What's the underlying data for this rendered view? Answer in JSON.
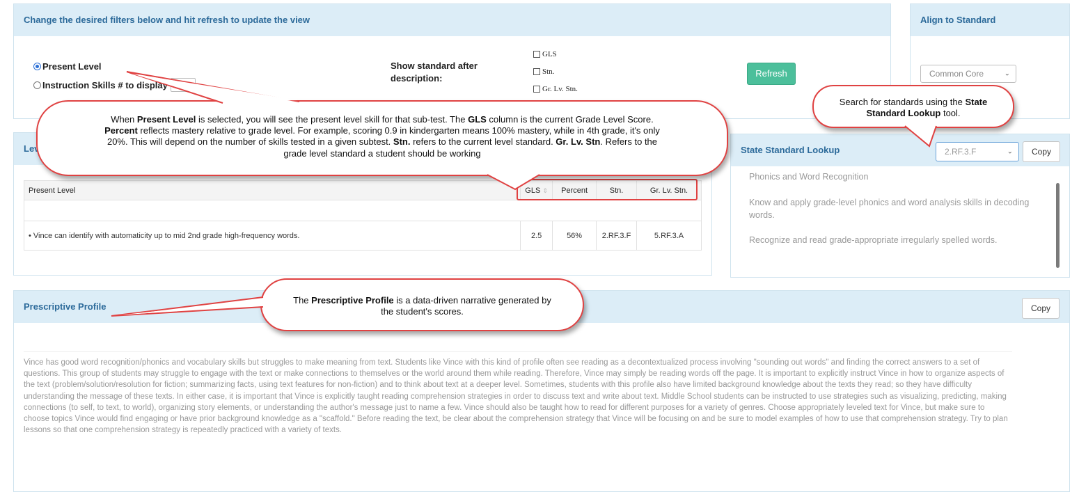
{
  "filters": {
    "header": "Change the desired filters below and hit refresh to update the view",
    "radio_present": "Present Level",
    "radio_instruction": "Instruction Skills # to display",
    "show_standard_label": "Show standard after description:",
    "checkboxes": [
      "GLS",
      "Stn.",
      "Gr. Lv. Stn."
    ],
    "refresh_label": "Refresh"
  },
  "align": {
    "header": "Align to Standard",
    "select_value": "Common Core"
  },
  "present": {
    "header": "Lev",
    "columns": [
      "Present Level",
      "GLS",
      "Percent",
      "Stn.",
      "Gr. Lv. Stn."
    ],
    "rows": [
      {
        "text": "• Vince can identify with automaticity up to mid 2nd grade high-frequency words.",
        "gls": "2.5",
        "percent": "56%",
        "stn": "2.RF.3.F",
        "gr_lv_stn": "5.RF.3.A"
      }
    ]
  },
  "lookup": {
    "header": "State Standard Lookup",
    "select_value": "2.RF.3.F",
    "copy_label": "Copy",
    "items": [
      "Phonics and Word Recognition",
      "Know and apply grade-level phonics and word analysis skills in decoding words.",
      "Recognize and read grade-appropriate irregularly spelled words."
    ]
  },
  "profile": {
    "header": "Prescriptive Profile",
    "copy_label": "Copy",
    "text": "Vince has good word recognition/phonics and vocabulary skills but struggles to make meaning from text. Students like Vince with this kind of profile often see reading as a decontextualized process involving \"sounding out words\" and finding the correct answers to a set of questions. This group of students may struggle to engage with the text or make connections to themselves or the world around them while reading. Therefore, Vince  may simply be reading words off the page. It is important to explicitly instruct Vince in how to organize aspects of the text (problem/solution/resolution for fiction; summarizing facts, using text features for non-fiction) and to think about text at a deeper level. Sometimes, students with this profile also have limited background knowledge about the texts they read; so they have difficulty understanding the message of these texts. In either case, it is important that Vince is explicitly taught reading comprehension strategies in order to discuss text and write about text. Middle School students can be instructed to use strategies such as visualizing, predicting, making connections (to self, to text, to world), organizing story elements, or understanding the author's message just to name a few. Vince should also be taught how to read for different purposes for a variety of genres. Choose appropriately leveled text for Vince, but make sure to choose topics Vince would find engaging or have prior background knowledge as a \"scaffold.\" Before reading the text, be clear about the comprehension strategy that Vince will be focusing on and be sure to model examples of how to use that comprehension strategy. Try to plan lessons so that one comprehension strategy is repeatedly practiced with a variety of texts."
  },
  "callouts": {
    "present_level": {
      "t1": "When ",
      "b1": "Present Level",
      "t2": " is selected, you will see the present level skill for that sub-test. The ",
      "b2": "GLS",
      "t3": " column is the current Grade Level Score. ",
      "b3": "Percent",
      "t4": " reflects mastery relative to grade level. For example, scoring 0.9 in kindergarten means 100% mastery, while in 4th grade, it's only 20%. This will depend on the number of skills tested in a given subtest. ",
      "b4": "Stn.",
      "t5": " refers to the current level standard. ",
      "b5": "Gr. Lv. Stn",
      "t6": ". Refers to the grade level standard a student should be working"
    },
    "lookup": {
      "t1": "Search for standards using the ",
      "b1": "State Standard Lookup",
      "t2": "  tool."
    },
    "profile": {
      "t1": "The ",
      "b1": "Prescriptive Profile",
      "t2": " is a data-driven narrative generated by the student's scores."
    }
  },
  "colors": {
    "header_bg": "#dcedf7",
    "header_text": "#2c6a9a",
    "refresh_bg": "#4cbf9b",
    "callout_border": "#e04242"
  }
}
